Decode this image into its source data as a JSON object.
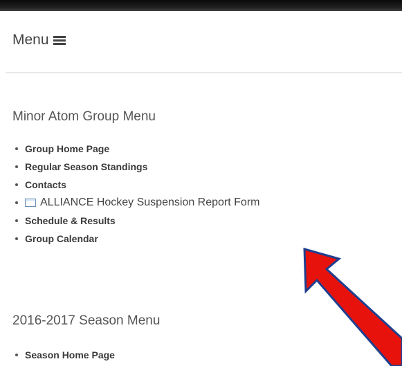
{
  "menu_toggle": {
    "label": "Menu",
    "icon": "hamburger-icon"
  },
  "group_menu": {
    "heading": "Minor Atom Group Menu",
    "items": [
      {
        "label": "Group Home Page"
      },
      {
        "label": "Regular Season Standings"
      },
      {
        "label": "Contacts"
      },
      {
        "label": "ALLIANCE Hockey Suspension Report Form",
        "icon": "form-icon"
      },
      {
        "label": "Schedule & Results"
      },
      {
        "label": "Group Calendar"
      }
    ]
  },
  "season_menu": {
    "heading": "2016-2017 Season Menu",
    "items": [
      {
        "label": "Season Home Page"
      }
    ]
  },
  "annotation": {
    "arrow_color": "#e8120c",
    "arrow_outline": "#1f3f8f"
  }
}
